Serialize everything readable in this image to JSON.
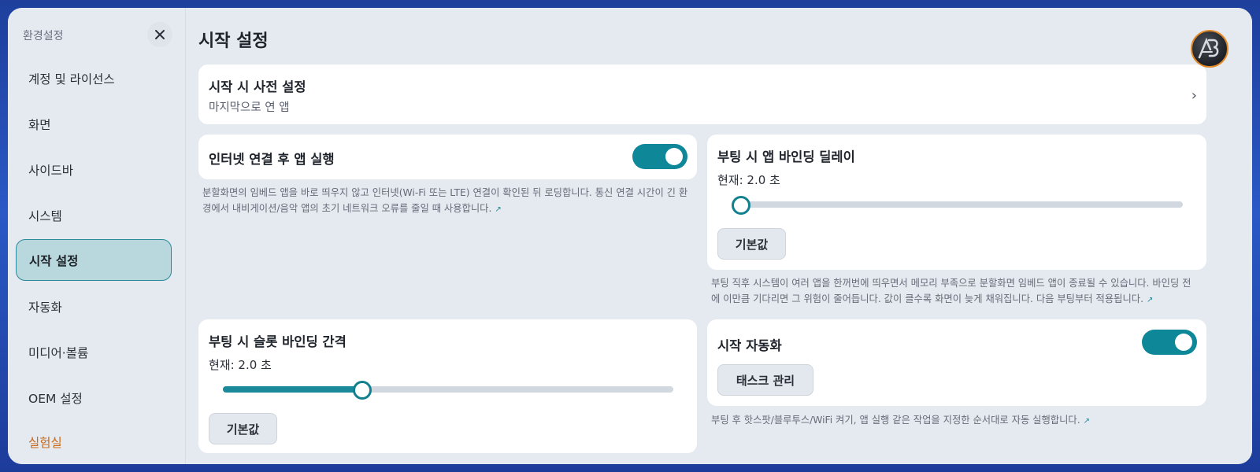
{
  "sidebar": {
    "header": "환경설정",
    "items": [
      {
        "label": "계정 및 라이선스"
      },
      {
        "label": "화면"
      },
      {
        "label": "사이드바"
      },
      {
        "label": "시스템"
      },
      {
        "label": "시작 설정"
      },
      {
        "label": "자동화"
      },
      {
        "label": "미디어·볼륨"
      },
      {
        "label": "OEM 설정"
      },
      {
        "label": "실험실"
      }
    ],
    "active_item": "시작 설정"
  },
  "page": {
    "title": "시작 설정"
  },
  "preset_card": {
    "title": "시작 시 사전 설정",
    "subtitle": "마지막으로 연 앱"
  },
  "internet_card": {
    "title": "인터넷 연결 후 앱 실행",
    "toggle_on": true,
    "desc_line1": "분할화면의 임베드 앱을 바로 띄우지 않고 인터넷(Wi-Fi 또는 LTE) 연결이 확인된 뒤 로딩합니다. 통신 연결 시간이 긴 환",
    "desc_line2": "경에서 내비게이션/음악 앱의 초기 네트워크 오류를 줄일 때 사용합니다."
  },
  "boot_delay_card": {
    "title": "부팅 시 앱 바인딩 딜레이",
    "current": "현재: 2.0 초",
    "slider_fraction": 0.02,
    "button": "기본값",
    "desc_line1": "부팅 직후 시스템이 여러 앱을 한꺼번에 띄우면서 메모리 부족으로 분할화면 임베드 앱이 종료될 수 있습니다. 바인딩 전",
    "desc_line2": "에 이만큼 기다리면 그 위험이 줄어듭니다. 값이 클수록 화면이 늦게 채워집니다. 다음 부팅부터 적용됩니다."
  },
  "slot_interval_card": {
    "title": "부팅 시 슬롯 바인딩 간격",
    "current": "현재: 2.0 초",
    "slider_fraction": 0.31,
    "button": "기본값"
  },
  "auto_card": {
    "title": "시작 자동화",
    "toggle_on": true,
    "button": "태스크 관리",
    "desc": "부팅 후 핫스팟/블루투스/WiFi 켜기, 앱 실행 같은 작업을 지정한 순서대로 자동 실행합니다."
  },
  "colors": {
    "accent": "#0e8799",
    "active_bg": "#b8d8dd",
    "lab": "#c86a1a"
  }
}
